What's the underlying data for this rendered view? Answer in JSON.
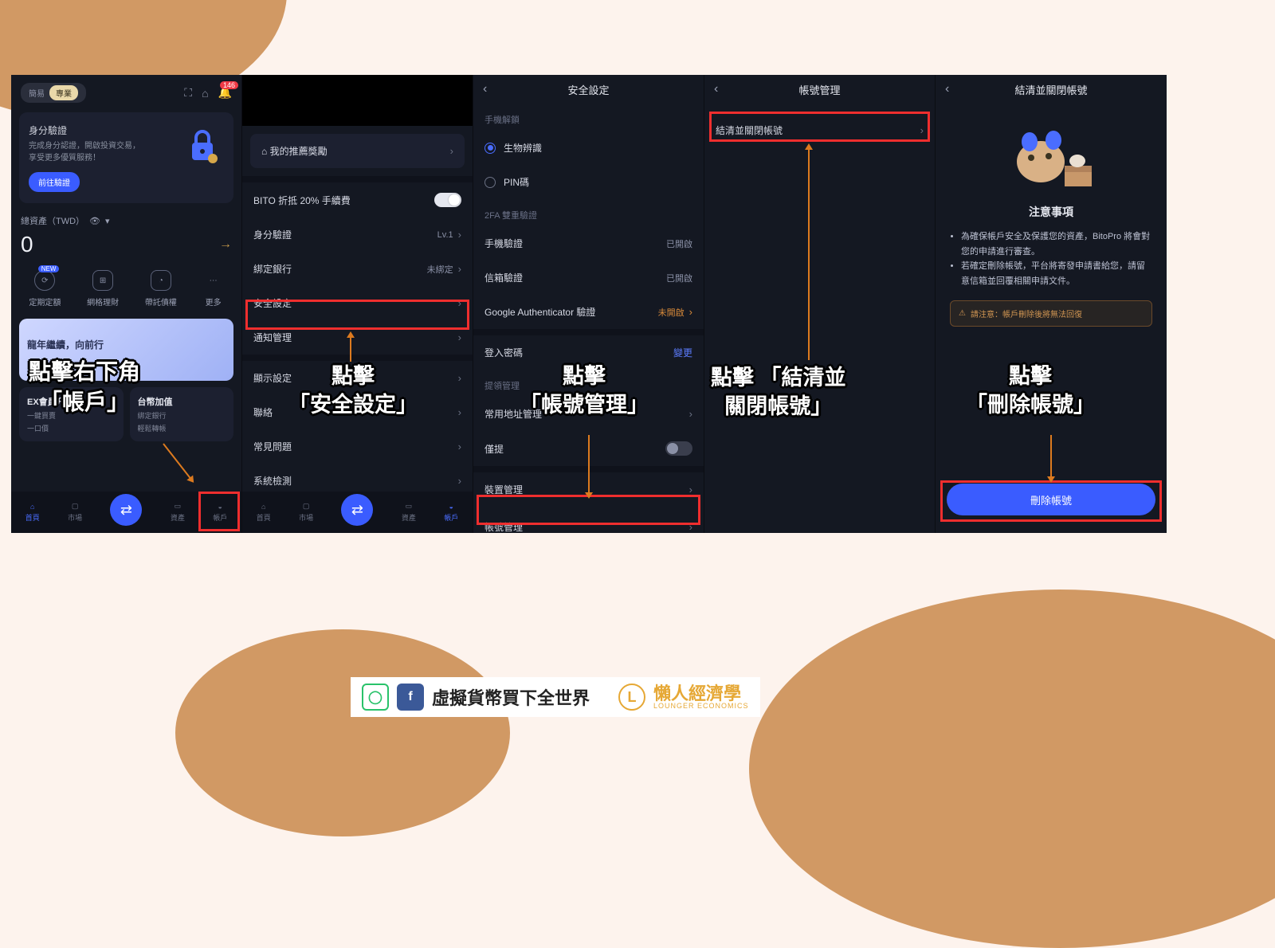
{
  "annotations": {
    "s1": "點擊右下角\n「帳戶」",
    "s2": "點擊\n「安全設定」",
    "s3": "點擊\n「帳號管理」",
    "s4": "點擊 「結清並\n關閉帳號」",
    "s5": "點擊\n「刪除帳號」"
  },
  "s1": {
    "tab_simple": "簡易",
    "tab_pro": "專業",
    "notif_count": "146",
    "verify_title": "身分驗證",
    "verify_desc1": "完成身分認證，開啟投資交易，",
    "verify_desc2": "享受更多優質服務！",
    "verify_btn": "前往驗證",
    "assets_label": "總資產（TWD）",
    "assets_value": "0",
    "svc": [
      "定期定額",
      "網格理財",
      "帶託債權",
      "更多"
    ],
    "new_badge": "NEW",
    "banner_title": "龍年繼續，向前行",
    "cardA_title": "EX會員升級",
    "cardA_sub1": "一鍵買賣",
    "cardA_sub2": "一口價",
    "cardB_title": "台幣加值",
    "cardB_sub1": "綁定銀行",
    "cardB_sub2": "輕鬆轉帳",
    "nav": [
      "首頁",
      "市場",
      "",
      "資產",
      "帳戶"
    ]
  },
  "s2": {
    "referral": "我的推薦獎勵",
    "bito_discount": "BITO 折抵 20% 手續費",
    "identity": "身分驗證",
    "identity_level": "Lv.1",
    "bank": "綁定銀行",
    "bank_status": "未綁定",
    "security": "安全設定",
    "notify": "通知管理",
    "display": "顯示設定",
    "contact": "聯絡",
    "faq": "常見問題",
    "syscheck": "系統檢測",
    "nav": [
      "首頁",
      "市場",
      "",
      "資產",
      "帳戶"
    ]
  },
  "s3": {
    "title": "安全設定",
    "sec_unlock": "手機解鎖",
    "bio": "生物辨識",
    "pin": "PIN碼",
    "sec_2fa": "2FA 雙重驗證",
    "phone_v": "手機驗證",
    "phone_s": "已開啟",
    "mail_v": "信箱驗證",
    "mail_s": "已開啟",
    "ga": "Google Authenticator 驗證",
    "ga_s": "未開啟",
    "pwd": "登入密碼",
    "pwd_s": "變更",
    "sec_withdraw": "提領管理",
    "addr": "常用地址管理",
    "only": "僅提",
    "device": "裝置管理",
    "account": "帳號管理"
  },
  "s4": {
    "title": "帳號管理",
    "close": "結清並關閉帳號"
  },
  "s5": {
    "title": "結清並關閉帳號",
    "notice_head": "注意事項",
    "b1": "為確保帳戶安全及保護您的資產，BitoPro 將會對您的申請進行審查。",
    "b2": "若確定刪除帳號，平台將寄發申請書給您，請留意信箱並回覆相關申請文件。",
    "warn": "請注意：帳戶刪除後將無法回復",
    "delete": "刪除帳號"
  },
  "footer": {
    "group1": "虛擬貨幣買下全世界",
    "group2_cn": "懶人經濟學",
    "group2_en": "LOUNGER ECONOMICS"
  }
}
